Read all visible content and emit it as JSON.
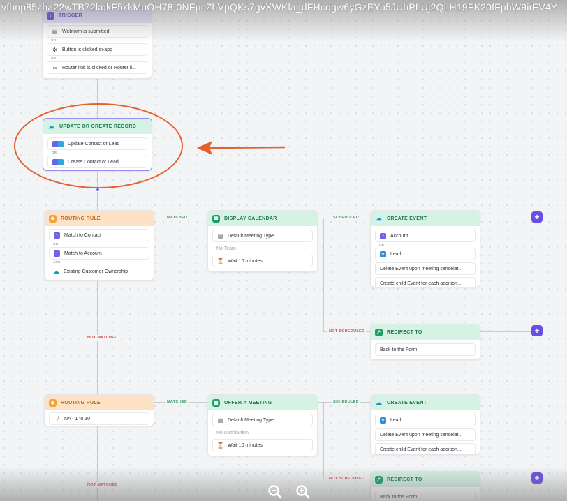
{
  "url_text": "vfhnp85zha22wTB72kqkF5xkMuOH78-0NFpcZhVpQKs7gvXWKla_dFHcqgw6yGzEYp5JUhPLUj2QLH19FK20fFphW9irFV4Y",
  "trigger": {
    "title": "TRIGGER",
    "items": [
      "Webform is submitted",
      "Button is clicked in-app",
      "Router link is clicked or Router li..."
    ],
    "separators": [
      "OR",
      "OR"
    ]
  },
  "update_record": {
    "title": "UPDATE OR CREATE RECORD",
    "items": [
      "Update Contact or Lead",
      "Create Contact or Lead"
    ],
    "separator": "OR"
  },
  "routing_rule_1": {
    "title": "ROUTING RULE",
    "items": [
      "Match to Contact",
      "Match to Account",
      "Existing Customer Ownership"
    ],
    "separators": [
      "OR",
      "AND"
    ]
  },
  "display_calendar": {
    "title": "DISPLAY CALENDAR",
    "items": [
      "Default Meeting Type",
      "No Team",
      "Wait 10 minutes"
    ]
  },
  "create_event_1": {
    "title": "CREATE EVENT",
    "items": [
      "Account",
      "Lead",
      "Delete Event upon meeting cancelat...",
      "Create child Event for each addition..."
    ],
    "separator": "OR"
  },
  "redirect_1": {
    "title": "REDIRECT TO",
    "items": [
      "Back to the Form"
    ]
  },
  "routing_rule_2": {
    "title": "ROUTING RULE",
    "items": [
      "NA - 1 to 10"
    ]
  },
  "offer_meeting": {
    "title": "OFFER A MEETING",
    "items": [
      "Default Meeting Type",
      "No Distribution",
      "Wait 10 minutes"
    ]
  },
  "create_event_2": {
    "title": "CREATE EVENT",
    "items": [
      "Lead",
      "Delete Event upon meeting cancelat...",
      "Create child Event for each addition..."
    ]
  },
  "redirect_2": {
    "title": "REDIRECT TO",
    "items": [
      "Back to the Form"
    ]
  },
  "labels": {
    "matched": "MATCHED",
    "not_matched": "NOT MATCHED",
    "scheduled": "SCHEDULED",
    "not_scheduled": "NOT SCHEDULED"
  },
  "plus_label": "+",
  "colors": {
    "accent": "#6a4fe6",
    "annotation": "#e4602f",
    "matched": "#3e9b6c",
    "not_matched": "#d64b4b"
  },
  "icons": [
    "calendar-icon",
    "cursor-click-icon",
    "link-icon",
    "salesforce-cloud-icon",
    "routing-icon",
    "hourglass-icon",
    "zoom-out-icon",
    "zoom-in-icon"
  ]
}
